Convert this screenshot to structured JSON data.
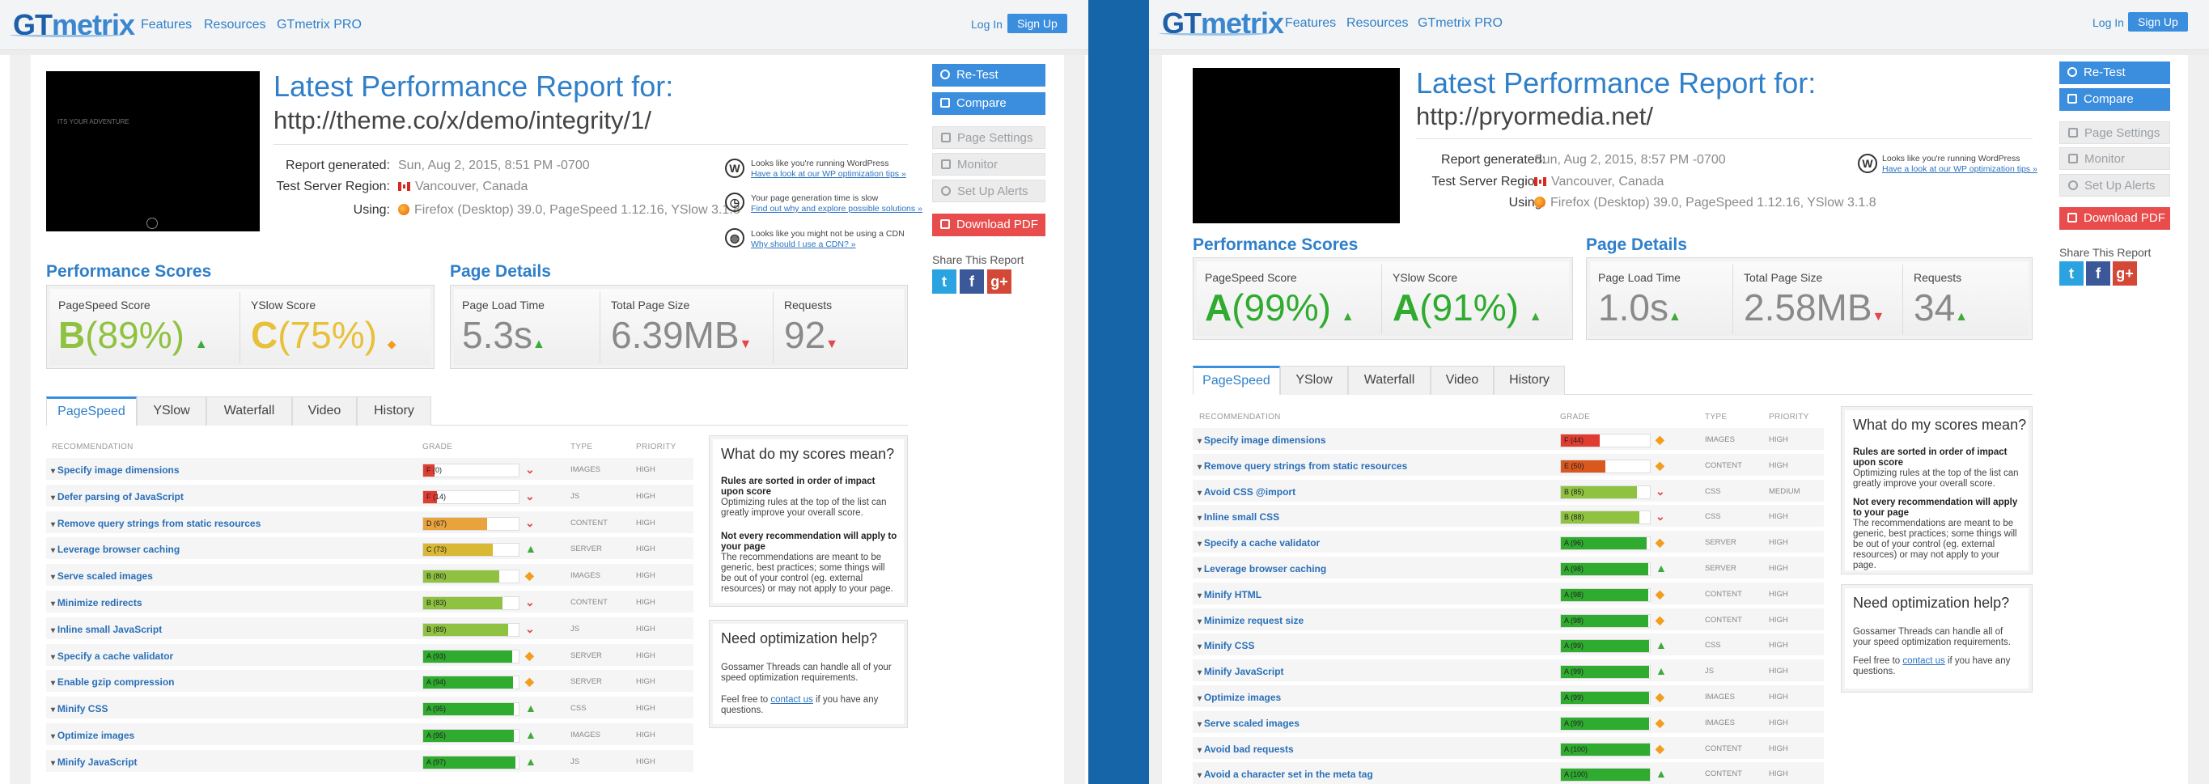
{
  "panels": [
    {
      "header": {
        "logo_a": "GT",
        "logo_b": "metrix",
        "nav": [
          "Features",
          "Resources",
          "GTmetrix PRO"
        ],
        "login": "Log In",
        "signup": "Sign Up"
      },
      "screenshot_caption": "ITS YOUR ADVENTURE",
      "title": "Latest Performance Report for:",
      "url": "http://theme.co/x/demo/integrity/1/",
      "meta": {
        "generated_label": "Report generated:",
        "generated": "Sun, Aug 2, 2015, 8:51 PM -0700",
        "region_label": "Test Server Region:",
        "region": "Vancouver, Canada",
        "using_label": "Using:",
        "using": "Firefox (Desktop) 39.0, PageSpeed 1.12.16, YSlow 3.1.8"
      },
      "notices": [
        {
          "text": "Looks like you're running WordPress",
          "link": "Have a look at our WP optimization tips »"
        },
        {
          "text": "Your page generation time is slow",
          "link": "Find out why and explore possible solutions »"
        },
        {
          "text": "Looks like you might not be using a CDN",
          "link": "Why should I use a CDN? »"
        }
      ],
      "sidebar": {
        "retest": "Re-Test",
        "compare": "Compare",
        "settings": "Page Settings",
        "monitor": "Monitor",
        "alerts": "Set Up Alerts",
        "pdf": "Download PDF",
        "share": "Share This Report"
      },
      "scores": {
        "heading": "Performance Scores",
        "pagespeed_label": "PageSpeed Score",
        "pagespeed_grade": "B",
        "pagespeed_pct": "(89%)",
        "yslow_label": "YSlow Score",
        "yslow_grade": "C",
        "yslow_pct": "(75%)"
      },
      "details": {
        "heading": "Page Details",
        "load_label": "Page Load Time",
        "load": "5.3s",
        "size_label": "Total Page Size",
        "size": "6.39MB",
        "req_label": "Requests",
        "req": "92"
      },
      "tabs": [
        "PageSpeed",
        "YSlow",
        "Waterfall",
        "Video",
        "History"
      ],
      "cols": {
        "rec": "RECOMMENDATION",
        "grade": "GRADE",
        "type": "TYPE",
        "priority": "PRIORITY"
      },
      "rows": [
        {
          "name": "Specify image dimensions",
          "grade": "F (0)",
          "score": 0,
          "color": "#e03c31",
          "trend": "dn",
          "type": "IMAGES",
          "priority": "HIGH"
        },
        {
          "name": "Defer parsing of JavaScript",
          "grade": "F (14)",
          "score": 14,
          "color": "#e03c31",
          "trend": "dn",
          "type": "JS",
          "priority": "HIGH"
        },
        {
          "name": "Remove query strings from static resources",
          "grade": "D (67)",
          "score": 67,
          "color": "#e8a33d",
          "trend": "dn",
          "type": "CONTENT",
          "priority": "HIGH"
        },
        {
          "name": "Leverage browser caching",
          "grade": "C (73)",
          "score": 73,
          "color": "#d9b834",
          "trend": "up",
          "type": "SERVER",
          "priority": "HIGH"
        },
        {
          "name": "Serve scaled images",
          "grade": "B (80)",
          "score": 80,
          "color": "#8fc240",
          "trend": "dia",
          "type": "IMAGES",
          "priority": "HIGH"
        },
        {
          "name": "Minimize redirects",
          "grade": "B (83)",
          "score": 83,
          "color": "#8fc240",
          "trend": "dn",
          "type": "CONTENT",
          "priority": "HIGH"
        },
        {
          "name": "Inline small JavaScript",
          "grade": "B (89)",
          "score": 89,
          "color": "#8fc240",
          "trend": "dn",
          "type": "JS",
          "priority": "HIGH"
        },
        {
          "name": "Specify a cache validator",
          "grade": "A (93)",
          "score": 93,
          "color": "#2fab2f",
          "trend": "dia",
          "type": "SERVER",
          "priority": "HIGH"
        },
        {
          "name": "Enable gzip compression",
          "grade": "A (94)",
          "score": 94,
          "color": "#2fab2f",
          "trend": "dia",
          "type": "SERVER",
          "priority": "HIGH"
        },
        {
          "name": "Minify CSS",
          "grade": "A (95)",
          "score": 95,
          "color": "#2fab2f",
          "trend": "up",
          "type": "CSS",
          "priority": "HIGH"
        },
        {
          "name": "Optimize images",
          "grade": "A (95)",
          "score": 95,
          "color": "#2fab2f",
          "trend": "up",
          "type": "IMAGES",
          "priority": "HIGH"
        },
        {
          "name": "Minify JavaScript",
          "grade": "A (97)",
          "score": 97,
          "color": "#2fab2f",
          "trend": "up",
          "type": "JS",
          "priority": "HIGH"
        }
      ],
      "help1": {
        "title": "What do my scores mean?",
        "b1": "Rules are sorted in order of impact upon score",
        "t1": "Optimizing rules at the top of the list can greatly improve your overall score.",
        "b2": "Not every recommendation will apply to your page",
        "t2": "The recommendations are meant to be generic, best practices; some things will be out of your control (eg. external resources) or may not apply to your page."
      },
      "help2": {
        "title": "Need optimization help?",
        "t1": "Gossamer Threads can handle all of your speed optimization requirements.",
        "t2a": "Feel free to ",
        "link": "contact us",
        "t2b": " if you have any questions."
      }
    },
    {
      "header": {
        "logo_a": "GT",
        "logo_b": "metrix",
        "nav": [
          "Features",
          "Resources",
          "GTmetrix PRO"
        ],
        "login": "Log In",
        "signup": "Sign Up"
      },
      "screenshot_caption": "",
      "title": "Latest Performance Report for:",
      "url": "http://pryormedia.net/",
      "meta": {
        "generated_label": "Report generated:",
        "generated": "Sun, Aug 2, 2015, 8:57 PM -0700",
        "region_label": "Test Server Region:",
        "region": "Vancouver, Canada",
        "using_label": "Using:",
        "using": "Firefox (Desktop) 39.0, PageSpeed 1.12.16, YSlow 3.1.8"
      },
      "notices": [
        {
          "text": "Looks like you're running WordPress",
          "link": "Have a look at our WP optimization tips »"
        }
      ],
      "sidebar": {
        "retest": "Re-Test",
        "compare": "Compare",
        "settings": "Page Settings",
        "monitor": "Monitor",
        "alerts": "Set Up Alerts",
        "pdf": "Download PDF",
        "share": "Share This Report"
      },
      "scores": {
        "heading": "Performance Scores",
        "pagespeed_label": "PageSpeed Score",
        "pagespeed_grade": "A",
        "pagespeed_pct": "(99%)",
        "yslow_label": "YSlow Score",
        "yslow_grade": "A",
        "yslow_pct": "(91%)"
      },
      "details": {
        "heading": "Page Details",
        "load_label": "Page Load Time",
        "load": "1.0s",
        "size_label": "Total Page Size",
        "size": "2.58MB",
        "req_label": "Requests",
        "req": "34"
      },
      "tabs": [
        "PageSpeed",
        "YSlow",
        "Waterfall",
        "Video",
        "History"
      ],
      "cols": {
        "rec": "RECOMMENDATION",
        "grade": "GRADE",
        "type": "TYPE",
        "priority": "PRIORITY"
      },
      "rows": [
        {
          "name": "Specify image dimensions",
          "grade": "F (44)",
          "score": 44,
          "color": "#e03c31",
          "trend": "dia",
          "type": "IMAGES",
          "priority": "HIGH"
        },
        {
          "name": "Remove query strings from static resources",
          "grade": "E (50)",
          "score": 50,
          "color": "#d9581e",
          "trend": "dia",
          "type": "CONTENT",
          "priority": "HIGH"
        },
        {
          "name": "Avoid CSS @import",
          "grade": "B (85)",
          "score": 85,
          "color": "#8fc240",
          "trend": "dn",
          "type": "CSS",
          "priority": "MEDIUM"
        },
        {
          "name": "Inline small CSS",
          "grade": "B (88)",
          "score": 88,
          "color": "#8fc240",
          "trend": "dn",
          "type": "CSS",
          "priority": "HIGH"
        },
        {
          "name": "Specify a cache validator",
          "grade": "A (96)",
          "score": 96,
          "color": "#2fab2f",
          "trend": "dia",
          "type": "SERVER",
          "priority": "HIGH"
        },
        {
          "name": "Leverage browser caching",
          "grade": "A (98)",
          "score": 98,
          "color": "#2fab2f",
          "trend": "up",
          "type": "SERVER",
          "priority": "HIGH"
        },
        {
          "name": "Minify HTML",
          "grade": "A (98)",
          "score": 98,
          "color": "#2fab2f",
          "trend": "dia",
          "type": "CONTENT",
          "priority": "HIGH"
        },
        {
          "name": "Minimize request size",
          "grade": "A (98)",
          "score": 98,
          "color": "#2fab2f",
          "trend": "dia",
          "type": "CONTENT",
          "priority": "HIGH"
        },
        {
          "name": "Minify CSS",
          "grade": "A (99)",
          "score": 99,
          "color": "#2fab2f",
          "trend": "up",
          "type": "CSS",
          "priority": "HIGH"
        },
        {
          "name": "Minify JavaScript",
          "grade": "A (99)",
          "score": 99,
          "color": "#2fab2f",
          "trend": "up",
          "type": "JS",
          "priority": "HIGH"
        },
        {
          "name": "Optimize images",
          "grade": "A (99)",
          "score": 99,
          "color": "#2fab2f",
          "trend": "dia",
          "type": "IMAGES",
          "priority": "HIGH"
        },
        {
          "name": "Serve scaled images",
          "grade": "A (99)",
          "score": 99,
          "color": "#2fab2f",
          "trend": "dia",
          "type": "IMAGES",
          "priority": "HIGH"
        },
        {
          "name": "Avoid bad requests",
          "grade": "A (100)",
          "score": 100,
          "color": "#2fab2f",
          "trend": "dia",
          "type": "CONTENT",
          "priority": "HIGH"
        },
        {
          "name": "Avoid a character set in the meta tag",
          "grade": "A (100)",
          "score": 100,
          "color": "#2fab2f",
          "trend": "up",
          "type": "CONTENT",
          "priority": "HIGH"
        }
      ],
      "help1": {
        "title": "What do my scores mean?",
        "b1": "Rules are sorted in order of impact upon score",
        "t1": "Optimizing rules at the top of the list can greatly improve your overall score.",
        "b2": "Not every recommendation will apply to your page",
        "t2": "The recommendations are meant to be generic, best practices; some things will be out of your control (eg. external resources) or may not apply to your page."
      },
      "help2": {
        "title": "Need optimization help?",
        "t1": "Gossamer Threads can handle all of your speed optimization requirements.",
        "t2a": "Feel free to ",
        "link": "contact us",
        "t2b": " if you have any questions."
      }
    }
  ]
}
